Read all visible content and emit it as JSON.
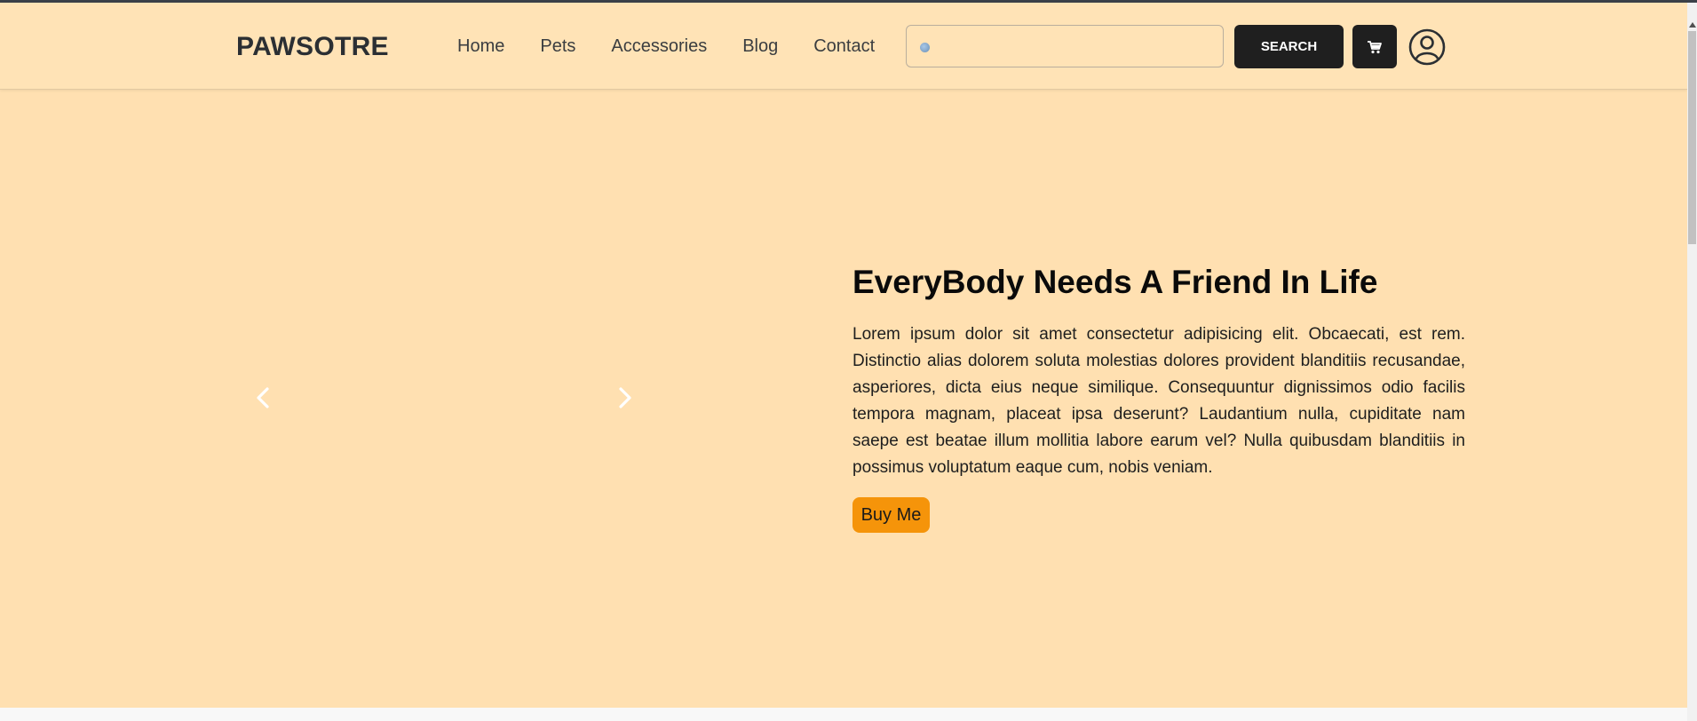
{
  "brand": "PAWSOTRE",
  "nav": {
    "links": [
      "Home",
      "Pets",
      "Accessories",
      "Blog",
      "Contact"
    ]
  },
  "search": {
    "value": "",
    "placeholder": "",
    "button_label": "SEARCH"
  },
  "icons": {
    "search": "search-icon",
    "cart": "cart-icon",
    "user": "user-circle-icon",
    "prev": "chevron-left-icon",
    "next": "chevron-right-icon"
  },
  "hero": {
    "title": "EveryBody Needs A Friend In Life",
    "text": "Lorem ipsum dolor sit amet consectetur adipisicing elit. Obcaecati, est rem. Distinctio alias dolorem soluta molestias dolores provident blanditiis recusandae, asperiores, dicta eius neque similique. Consequuntur dignissimos odio facilis tempora magnam, placeat ipsa deserunt? Laudantium nulla, cupiditate nam saepe est beatae illum mollitia labore earum vel? Nulla quibusdam blanditiis in possimus voluptatum eaque cum, nobis veniam.",
    "button_label": "Buy Me"
  },
  "colors": {
    "background": "#ffe0b1",
    "navbar": "#ffe3b6",
    "button_dark": "#1f1f1f",
    "accent": "#f5940a"
  }
}
